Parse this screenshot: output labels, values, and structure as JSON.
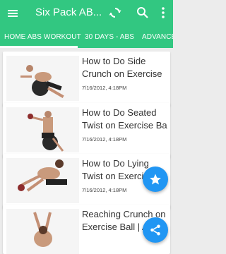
{
  "app": {
    "title": "Six Pack AB...",
    "accent": "#32c781",
    "fab_color": "#2196f3"
  },
  "tabs": [
    {
      "label": "HOME ABS WORKOUT"
    },
    {
      "label": "30 DAYS - ABS"
    },
    {
      "label": "ADVANCED"
    }
  ],
  "videos": [
    {
      "title": "How to Do Side Crunch on Exercise",
      "date": "7/16/2012, 4:18PM"
    },
    {
      "title": "How to Do Seated Twist on Exercise Ba",
      "date": "7/16/2012, 4:18PM"
    },
    {
      "title": "How to Do Lying Twist on Exercise Ball",
      "date": "7/16/2012, 4:18PM"
    },
    {
      "title": "Reaching Crunch on Exercise Ball | A",
      "date": ""
    }
  ],
  "icons": {
    "menu": "menu-icon",
    "refresh": "refresh-icon",
    "search": "search-icon",
    "more": "more-vert-icon",
    "star": "star-icon",
    "share": "share-icon"
  }
}
